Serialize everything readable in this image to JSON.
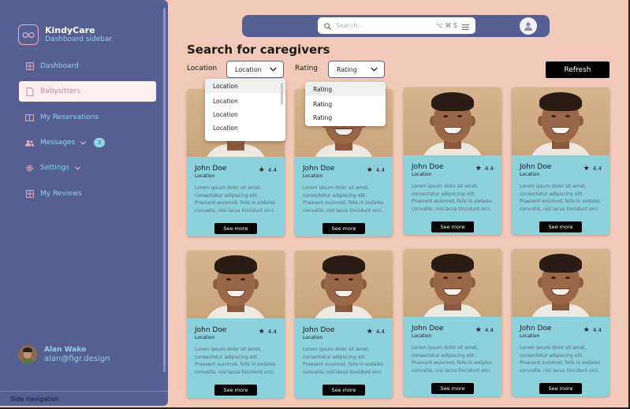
{
  "brand": {
    "title": "KindyCare",
    "subtitle": "Dashboard sidebar"
  },
  "nav": [
    {
      "label": "Dashboard",
      "icon": "grid-icon"
    },
    {
      "label": "Babysitters",
      "icon": "document-icon",
      "active": true
    },
    {
      "label": "My Reservations",
      "icon": "columns-icon"
    },
    {
      "label": "Messages",
      "icon": "users-icon",
      "badge": "3"
    },
    {
      "label": "Settings",
      "icon": "gear-icon"
    },
    {
      "label": "My Reviews",
      "icon": "grid-icon"
    }
  ],
  "user": {
    "name": "Alan Wake",
    "email": "alan@figr.design"
  },
  "footer": {
    "label": "Side navigation"
  },
  "search": {
    "placeholder": "Search...",
    "shortcut": "⌥ ⌘ S"
  },
  "page": {
    "title": "Search for caregivers"
  },
  "filters": {
    "location_label": "Location",
    "location_value": "Location",
    "rating_label": "Rating",
    "rating_value": "Rating",
    "location_options": [
      "Location",
      "Location",
      "Location",
      "Location"
    ],
    "rating_options": [
      "Rating",
      "Rating",
      "Rating"
    ]
  },
  "refresh_label": "Refresh",
  "cards": [
    {
      "name": "John Doe",
      "location": "Location",
      "rating": "4.4",
      "description": "Lorem ipsum dolor sit amet, consectetur adipiscing elit. Praesent euismod, felis in sodales convallis, nisl lacus tincidunt orci.",
      "button": "See more"
    },
    {
      "name": "John Doe",
      "location": "Location",
      "rating": "4.4",
      "description": "Lorem ipsum dolor sit amet, consectetur adipiscing elit. Praesent euismod, felis in sodales convallis, nisl lacus tincidunt orci.",
      "button": "See more"
    },
    {
      "name": "John Doe",
      "location": "Location",
      "rating": "4.4",
      "description": "Lorem ipsum dolor sit amet, consectetur adipiscing elit. Praesent euismod, felis in sodales convallis, nisl lacus tincidunt orci.",
      "button": "See more"
    },
    {
      "name": "John Doe",
      "location": "Location",
      "rating": "4.4",
      "description": "Lorem ipsum dolor sit amet, consectetur adipiscing elit. Praesent euismod, felis in sodales convallis, nisl lacus tincidunt orci.",
      "button": "See more"
    },
    {
      "name": "John Doe",
      "location": "Location",
      "rating": "4.4",
      "description": "Lorem ipsum dolor sit amet, consectetur adipiscing elit. Praesent euismod, felis in sodales convallis, nisl lacus tincidunt orci.",
      "button": "See more"
    },
    {
      "name": "John Doe",
      "location": "Location",
      "rating": "4.4",
      "description": "Lorem ipsum dolor sit amet, consectetur adipiscing elit. Praesent euismod, felis in sodales convallis, nisl lacus tincidunt orci.",
      "button": "See more"
    },
    {
      "name": "John Doe",
      "location": "Location",
      "rating": "4.4",
      "description": "Lorem ipsum dolor sit amet, consectetur adipiscing elit. Praesent euismod, felis in sodales convallis, nisl lacus tincidunt orci.",
      "button": "See more"
    },
    {
      "name": "John Doe",
      "location": "Location",
      "rating": "4.4",
      "description": "Lorem ipsum dolor sit amet, consectetur adipiscing elit. Praesent euismod, felis in sodales convallis, nisl lacus tincidunt orci.",
      "button": "See more"
    }
  ],
  "colors": {
    "sidebar": "#565f92",
    "background": "#f2c9b8",
    "card": "#8bd2dc",
    "accent_pink": "#e77c9a",
    "accent_cyan": "#8fd6e0"
  }
}
